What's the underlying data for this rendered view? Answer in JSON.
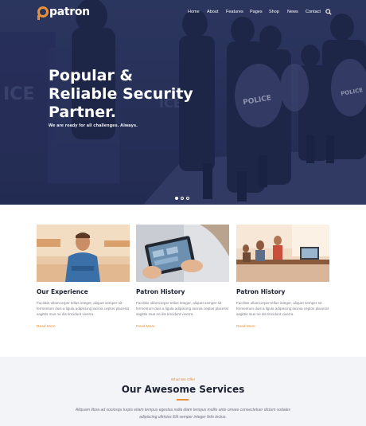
{
  "brand": {
    "logo_text": "patron",
    "accent": "#e8913a"
  },
  "nav": {
    "items": [
      "Home",
      "About",
      "Features",
      "Pages",
      "Shop",
      "News",
      "Contact"
    ],
    "search_icon": "search-icon"
  },
  "hero": {
    "title_line1": "Popular &",
    "title_line2": "Reliable Security",
    "title_line3": "Partner.",
    "subtitle": "We are ready for all challenges.  Always.",
    "slide_count": 3,
    "active_slide": 1
  },
  "cards": [
    {
      "title": "Our Experience",
      "text": "Facilisis ullamcorper tellus integer, aliquet semper sit fermentum duis a ligula adipiscing lacinia ceptos placerat sagittis mus ne dis tincidunt viverra.",
      "link": "Read More"
    },
    {
      "title": "Patron History",
      "text": "Facilisis ullamcorper tellus integer, aliquet semper sit fermentum duis a ligula adipiscing lacinia ceptos placerat sagittis mus ne dis tincidunt viverra.",
      "link": "Read More"
    },
    {
      "title": "Patron History",
      "text": "Facilisis ullamcorper tellus integer, aliquet semper sit fermentum duis a ligula adipiscing lacinia ceptos placerat sagittis mus ne dis tincidunt viverra.",
      "link": "Read More"
    }
  ],
  "services": {
    "eyebrow": "What We Offer",
    "title": "Our Awesome Services",
    "description": "Aliquam litora ad sociosqu turpis etiam tempus egestas nulla diam tempus mollis ante ornare consectetuer dictum sodales adipiscing ultricies Elit semper integer felis lectus."
  }
}
